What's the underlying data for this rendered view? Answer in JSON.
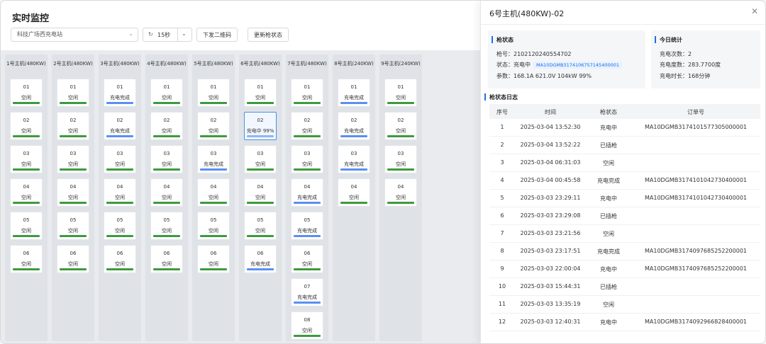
{
  "header": {
    "title": "实时监控",
    "station": "科技广场西充电站",
    "interval": "15秒",
    "btn_qr": "下发二维码",
    "btn_update": "更新枪状态"
  },
  "colors": {
    "bar_idle": "#3d9a3d",
    "bar_done": "#5b8ff0",
    "bar_charging": "#8db6f5",
    "accent": "#1f6fe5"
  },
  "hosts": [
    {
      "name": "1号主机(480KW)",
      "guns": [
        {
          "num": "01",
          "status": "空闲",
          "kind": "idle"
        },
        {
          "num": "02",
          "status": "空闲",
          "kind": "idle"
        },
        {
          "num": "03",
          "status": "空闲",
          "kind": "idle"
        },
        {
          "num": "04",
          "status": "空闲",
          "kind": "idle"
        },
        {
          "num": "05",
          "status": "空闲",
          "kind": "idle"
        },
        {
          "num": "06",
          "status": "空闲",
          "kind": "idle"
        }
      ]
    },
    {
      "name": "2号主机(480KW)",
      "guns": [
        {
          "num": "01",
          "status": "空闲",
          "kind": "idle"
        },
        {
          "num": "02",
          "status": "空闲",
          "kind": "idle"
        },
        {
          "num": "03",
          "status": "空闲",
          "kind": "idle"
        },
        {
          "num": "04",
          "status": "空闲",
          "kind": "idle"
        },
        {
          "num": "05",
          "status": "空闲",
          "kind": "idle"
        },
        {
          "num": "06",
          "status": "空闲",
          "kind": "idle"
        }
      ]
    },
    {
      "name": "3号主机(480KW)",
      "guns": [
        {
          "num": "01",
          "status": "充电完成",
          "kind": "done"
        },
        {
          "num": "02",
          "status": "充电完成",
          "kind": "done"
        },
        {
          "num": "03",
          "status": "空闲",
          "kind": "idle"
        },
        {
          "num": "04",
          "status": "空闲",
          "kind": "idle"
        },
        {
          "num": "05",
          "status": "空闲",
          "kind": "idle"
        },
        {
          "num": "06",
          "status": "空闲",
          "kind": "idle"
        }
      ]
    },
    {
      "name": "4号主机(480KW)",
      "guns": [
        {
          "num": "01",
          "status": "空闲",
          "kind": "idle"
        },
        {
          "num": "02",
          "status": "空闲",
          "kind": "idle"
        },
        {
          "num": "03",
          "status": "空闲",
          "kind": "idle"
        },
        {
          "num": "04",
          "status": "空闲",
          "kind": "idle"
        },
        {
          "num": "05",
          "status": "空闲",
          "kind": "idle"
        },
        {
          "num": "06",
          "status": "空闲",
          "kind": "idle"
        }
      ]
    },
    {
      "name": "5号主机(480KW)",
      "guns": [
        {
          "num": "01",
          "status": "空闲",
          "kind": "idle"
        },
        {
          "num": "02",
          "status": "空闲",
          "kind": "idle"
        },
        {
          "num": "03",
          "status": "充电完成",
          "kind": "done"
        },
        {
          "num": "04",
          "status": "空闲",
          "kind": "idle"
        },
        {
          "num": "05",
          "status": "空闲",
          "kind": "idle"
        },
        {
          "num": "06",
          "status": "空闲",
          "kind": "idle"
        }
      ]
    },
    {
      "name": "6号主机(480KW)",
      "guns": [
        {
          "num": "01",
          "status": "空闲",
          "kind": "idle"
        },
        {
          "num": "02",
          "status": "充电中 99%",
          "kind": "charging"
        },
        {
          "num": "03",
          "status": "空闲",
          "kind": "idle"
        },
        {
          "num": "04",
          "status": "空闲",
          "kind": "idle"
        },
        {
          "num": "05",
          "status": "空闲",
          "kind": "idle"
        },
        {
          "num": "06",
          "status": "充电完成",
          "kind": "done"
        }
      ]
    },
    {
      "name": "7号主机(480KW)",
      "guns": [
        {
          "num": "01",
          "status": "空闲",
          "kind": "idle"
        },
        {
          "num": "02",
          "status": "空闲",
          "kind": "idle"
        },
        {
          "num": "03",
          "status": "空闲",
          "kind": "idle"
        },
        {
          "num": "04",
          "status": "充电完成",
          "kind": "done"
        },
        {
          "num": "05",
          "status": "充电完成",
          "kind": "done"
        },
        {
          "num": "06",
          "status": "空闲",
          "kind": "idle"
        },
        {
          "num": "07",
          "status": "充电完成",
          "kind": "done"
        },
        {
          "num": "08",
          "status": "空闲",
          "kind": "idle"
        }
      ]
    },
    {
      "name": "8号主机(240KW)",
      "guns": [
        {
          "num": "01",
          "status": "充电完成",
          "kind": "done"
        },
        {
          "num": "02",
          "status": "充电完成",
          "kind": "done"
        },
        {
          "num": "03",
          "status": "充电完成",
          "kind": "done"
        },
        {
          "num": "04",
          "status": "空闲",
          "kind": "idle"
        }
      ]
    },
    {
      "name": "9号主机(240KW)",
      "guns": [
        {
          "num": "01",
          "status": "空闲",
          "kind": "idle"
        },
        {
          "num": "02",
          "status": "空闲",
          "kind": "idle"
        },
        {
          "num": "03",
          "status": "空闲",
          "kind": "idle"
        },
        {
          "num": "04",
          "status": "空闲",
          "kind": "idle"
        }
      ]
    }
  ],
  "panel": {
    "title": "6号主机(480KW)-02",
    "gun_status": {
      "title": "枪状态",
      "gun_no": "枪号：2102120240554702",
      "state_label": "状态：充电中",
      "order_no": "MA10DGMB3174106757145400001",
      "params": "参数：168.1A  621.0V  104kW  99%"
    },
    "today": {
      "title": "今日统计",
      "count": "充电次数：2",
      "energy": "充电度数：283.7700度",
      "duration": "充电时长：168分钟"
    },
    "log": {
      "title": "枪状态日志",
      "headers": [
        "序号",
        "时间",
        "枪状态",
        "订单号"
      ],
      "rows": [
        {
          "seq": "1",
          "time": "2025-03-04 13:52:30",
          "state": "充电中",
          "order": "MA10DGMB3174101577305000001"
        },
        {
          "seq": "2",
          "time": "2025-03-04 13:52:22",
          "state": "已插枪",
          "order": ""
        },
        {
          "seq": "3",
          "time": "2025-03-04 06:31:03",
          "state": "空闲",
          "order": ""
        },
        {
          "seq": "4",
          "time": "2025-03-04 00:45:58",
          "state": "充电完成",
          "order": "MA10DGMB3174101042730400001"
        },
        {
          "seq": "5",
          "time": "2025-03-03 23:29:11",
          "state": "充电中",
          "order": "MA10DGMB3174101042730400001"
        },
        {
          "seq": "6",
          "time": "2025-03-03 23:29:08",
          "state": "已插枪",
          "order": ""
        },
        {
          "seq": "7",
          "time": "2025-03-03 23:21:56",
          "state": "空闲",
          "order": ""
        },
        {
          "seq": "8",
          "time": "2025-03-03 23:17:51",
          "state": "充电完成",
          "order": "MA10DGMB3174097685252200001"
        },
        {
          "seq": "9",
          "time": "2025-03-03 22:00:04",
          "state": "充电中",
          "order": "MA10DGMB3174097685252200001"
        },
        {
          "seq": "10",
          "time": "2025-03-03 15:44:31",
          "state": "已插枪",
          "order": ""
        },
        {
          "seq": "11",
          "time": "2025-03-03 13:35:19",
          "state": "空闲",
          "order": ""
        },
        {
          "seq": "12",
          "time": "2025-03-03 12:40:31",
          "state": "充电中",
          "order": "MA10DGMB3174092966828400001"
        }
      ]
    }
  }
}
